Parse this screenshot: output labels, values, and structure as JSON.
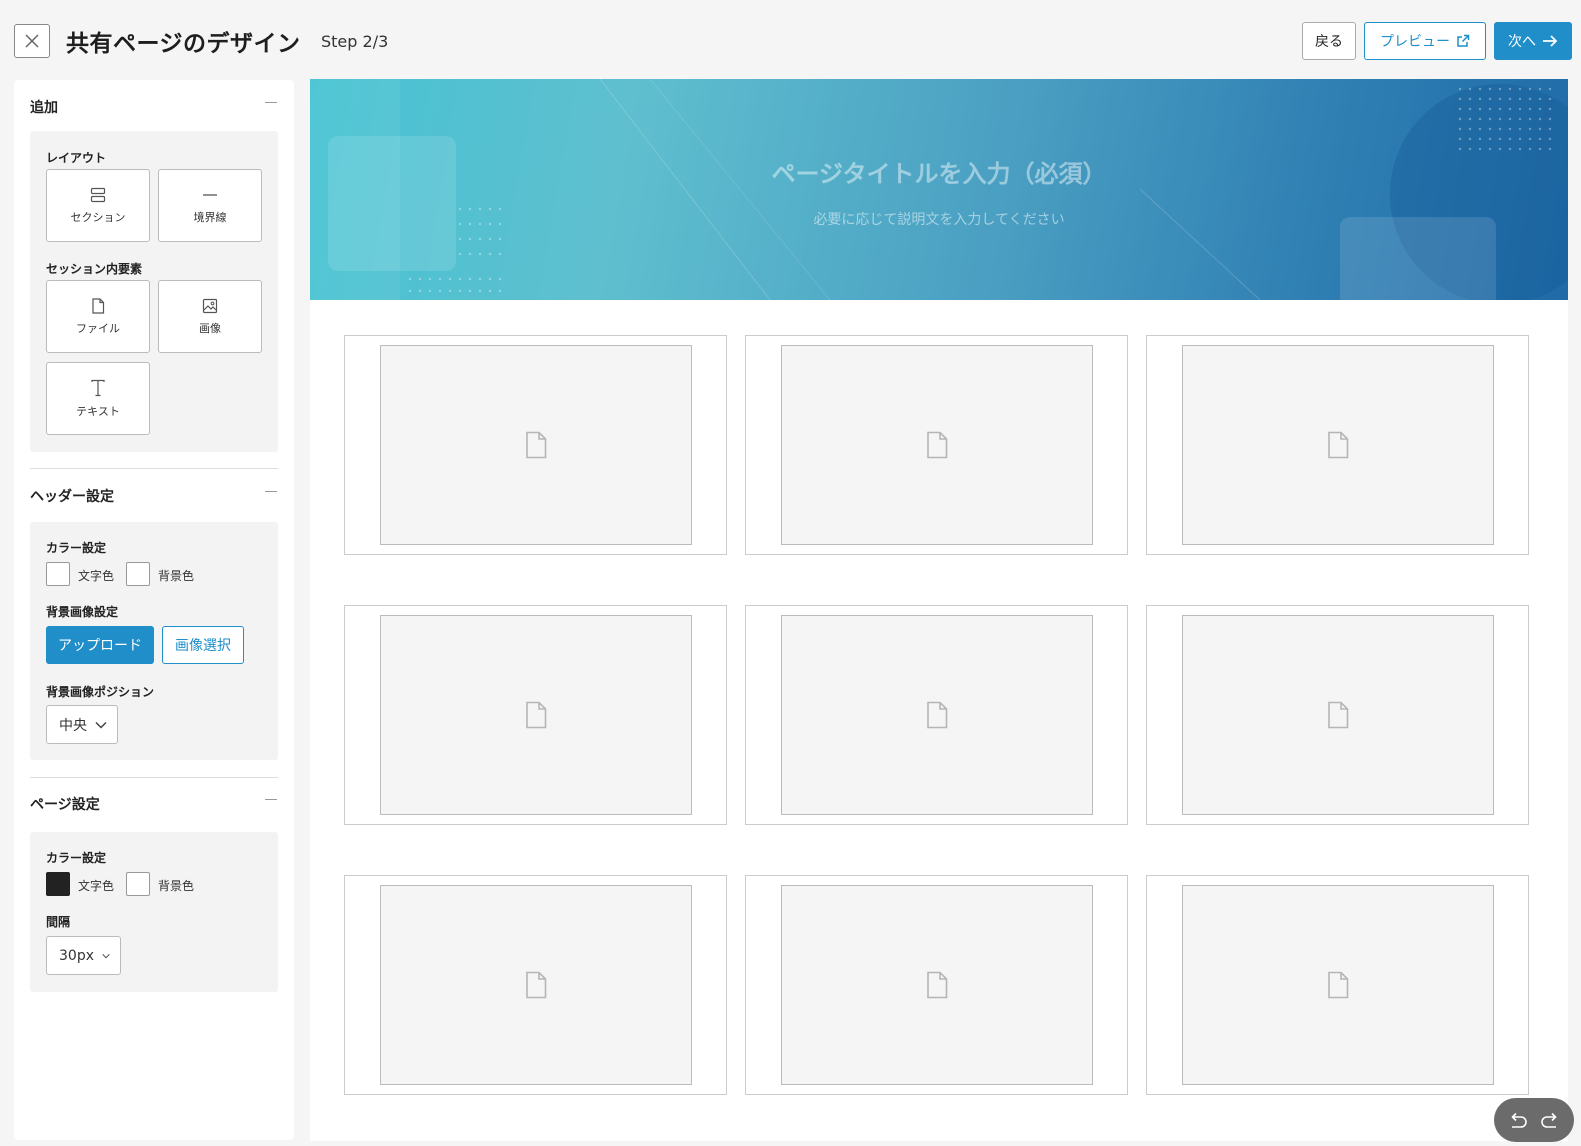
{
  "header": {
    "title": "共有ページのデザイン",
    "step": "Step 2/3",
    "back_label": "戻る",
    "preview_label": "プレビュー",
    "next_label": "次へ"
  },
  "sidebar": {
    "add": {
      "title": "追加",
      "layout_label": "レイアウト",
      "layout_items": [
        {
          "label": "セクション",
          "icon": "section-icon"
        },
        {
          "label": "境界線",
          "icon": "divider-icon"
        }
      ],
      "elements_label": "セッション内要素",
      "element_items": [
        {
          "label": "ファイル",
          "icon": "file-icon"
        },
        {
          "label": "画像",
          "icon": "image-icon"
        },
        {
          "label": "テキスト",
          "icon": "text-icon"
        }
      ]
    },
    "header_settings": {
      "title": "ヘッダー設定",
      "color_label": "カラー設定",
      "text_color_label": "文字色",
      "bg_color_label": "背景色",
      "bg_image_label": "背景画像設定",
      "upload_label": "アップロード",
      "select_image_label": "画像選択",
      "position_label": "背景画像ポジション",
      "position_value": "中央"
    },
    "page_settings": {
      "title": "ページ設定",
      "color_label": "カラー設定",
      "text_color_label": "文字色",
      "bg_color_label": "背景色",
      "spacing_label": "間隔",
      "spacing_value": "30px"
    }
  },
  "canvas": {
    "hero_title": "ページタイトルを入力（必須）",
    "hero_subtitle": "必要に応じて説明文を入力してください",
    "accent_color": "#1f8ec9"
  }
}
